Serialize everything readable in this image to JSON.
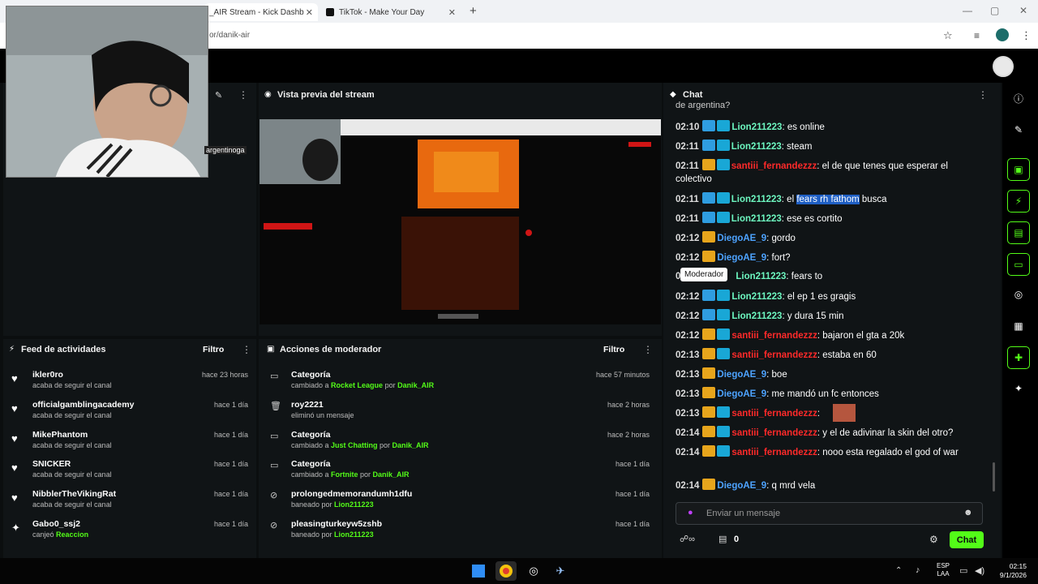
{
  "browser": {
    "tabs": [
      {
        "label": "_AIR Stream - Kick Dashb",
        "close": "✕"
      },
      {
        "label": "TikTok - Make Your Day",
        "close": "✕"
      }
    ],
    "new_tab": "+",
    "url": "or/danik-air",
    "webcam_overlay_text": "argentinoga"
  },
  "preview": {
    "title": "Vista previa del stream"
  },
  "chat": {
    "title": "Chat",
    "top_partial": "de argentina?",
    "tooltip": "Moderador",
    "input_placeholder": "Enviar un mensaje",
    "counter": "0",
    "send_label": "Chat",
    "messages": [
      {
        "ts": "02:10",
        "user": "Lion211223",
        "type": "lion",
        "badges": [
          "sword",
          "mod"
        ],
        "text": ": es online"
      },
      {
        "ts": "02:11",
        "user": "Lion211223",
        "type": "lion",
        "badges": [
          "sword",
          "mod"
        ],
        "text": ": steam"
      },
      {
        "ts": "02:11",
        "user": "santiii_fernandezzz",
        "type": "santi",
        "badges": [
          "crown",
          "mod"
        ],
        "text": ": el de que tenes que esperar el colectivo"
      },
      {
        "ts": "02:11",
        "user": "Lion211223",
        "type": "lion",
        "badges": [
          "sword",
          "mod"
        ],
        "text_pre": ": el ",
        "text_hl": "fears rh fathom",
        "text_post": " busca"
      },
      {
        "ts": "02:11",
        "user": "Lion211223",
        "type": "lion",
        "badges": [
          "sword",
          "mod"
        ],
        "text": ": ese es cortito"
      },
      {
        "ts": "02:12",
        "user": "DiegoAE_9",
        "type": "diego",
        "badges": [
          "crown"
        ],
        "text": ": gordo"
      },
      {
        "ts": "02:12",
        "user": "DiegoAE_9",
        "type": "diego",
        "badges": [
          "crown"
        ],
        "text": ": fort?"
      },
      {
        "ts": "0",
        "user": "Lion211223",
        "type": "lion",
        "badges": [],
        "text": ": fears to"
      },
      {
        "ts": "02:12",
        "user": "Lion211223",
        "type": "lion",
        "badges": [
          "sword",
          "mod"
        ],
        "text": ": el ep 1 es gragis"
      },
      {
        "ts": "02:12",
        "user": "Lion211223",
        "type": "lion",
        "badges": [
          "sword",
          "mod"
        ],
        "text": ": y dura 15 min"
      },
      {
        "ts": "02:12",
        "user": "santiii_fernandezzz",
        "type": "santi",
        "badges": [
          "crown",
          "mod"
        ],
        "text": ": bajaron el gta a 20k"
      },
      {
        "ts": "02:13",
        "user": "santiii_fernandezzz",
        "type": "santi",
        "badges": [
          "crown",
          "mod"
        ],
        "text": ": estaba en 60"
      },
      {
        "ts": "02:13",
        "user": "DiegoAE_9",
        "type": "diego",
        "badges": [
          "crown"
        ],
        "text": ": boe"
      },
      {
        "ts": "02:13",
        "user": "DiegoAE_9",
        "type": "diego",
        "badges": [
          "crown"
        ],
        "text": ": me mandó un fc entonces"
      },
      {
        "ts": "02:13",
        "user": "santiii_fernandezzz",
        "type": "santi",
        "badges": [
          "crown",
          "mod"
        ],
        "text": ":"
      },
      {
        "ts": "02:14",
        "user": "santiii_fernandezzz",
        "type": "santi",
        "badges": [
          "crown",
          "mod"
        ],
        "text": ": y el de adivinar la skin del otro?"
      },
      {
        "ts": "02:14",
        "user": "santiii_fernandezzz",
        "type": "santi",
        "badges": [
          "crown",
          "mod"
        ],
        "text": ": nooo esta regalado el god of war"
      },
      {
        "ts": "02:14",
        "user": "DiegoAE_9",
        "type": "diego",
        "badges": [
          "crown"
        ],
        "text": ": q mrd vela"
      }
    ]
  },
  "activity": {
    "title": "Feed de actividades",
    "filter": "Filtro",
    "items": [
      {
        "icon": "heart",
        "name": "ikler0ro",
        "sub": "acaba de seguir el canal",
        "time": "hace 23 horas"
      },
      {
        "icon": "heart",
        "name": "officialgamblingacademy",
        "sub": "acaba de seguir el canal",
        "time": "hace 1 día"
      },
      {
        "icon": "heart",
        "name": "MikePhantom",
        "sub": "acaba de seguir el canal",
        "time": "hace 1 día"
      },
      {
        "icon": "heart",
        "name": "SNICKER",
        "sub": "acaba de seguir el canal",
        "time": "hace 1 día"
      },
      {
        "icon": "heart",
        "name": "NibblerTheVikingRat",
        "sub": "acaba de seguir el canal",
        "time": "hace 1 día"
      },
      {
        "icon": "points",
        "name": "Gabo0_ssj2",
        "sub": "canjeó",
        "sub_hl": "Reaccion",
        "time": "hace 1 día"
      }
    ]
  },
  "moderator": {
    "title": "Acciones de moderador",
    "filter": "Filtro",
    "items": [
      {
        "icon": "category",
        "name": "Categoría",
        "sub1": "cambiado a ",
        "hl1": "Rocket League",
        "sub2": " por ",
        "hl2": "Danik_AIR",
        "time": "hace 57 minutos"
      },
      {
        "icon": "trash",
        "name": "roy2221",
        "sub1": "eliminó un mensaje",
        "hl1": "",
        "sub2": "",
        "hl2": "",
        "time": "hace 2 horas"
      },
      {
        "icon": "category",
        "name": "Categoría",
        "sub1": "cambiado a ",
        "hl1": "Just Chatting",
        "sub2": " por ",
        "hl2": "Danik_AIR",
        "time": "hace 2 horas"
      },
      {
        "icon": "category",
        "name": "Categoría",
        "sub1": "cambiado a ",
        "hl1": "Fortnite",
        "sub2": " por ",
        "hl2": "Danik_AIR",
        "time": "hace 1 día"
      },
      {
        "icon": "ban",
        "name": "prolongedmemorandumh1dfu",
        "sub1": "baneado por ",
        "hl1": "Lion211223",
        "sub2": "",
        "hl2": "",
        "time": "hace 1 día"
      },
      {
        "icon": "ban",
        "name": "pleasingturkeyw5zshb",
        "sub1": "baneado por ",
        "hl1": "Lion211223",
        "sub2": "",
        "hl2": "",
        "time": "hace 1 día"
      }
    ]
  },
  "taskbar": {
    "lang": "ESP",
    "lang2": "LAA",
    "time": "02:15",
    "date": "9/1/2026"
  },
  "colors": {
    "kick_green": "#53fc18",
    "lion": "#6df7c0",
    "santi": "#ff2a2a",
    "diego": "#4da3ff"
  }
}
